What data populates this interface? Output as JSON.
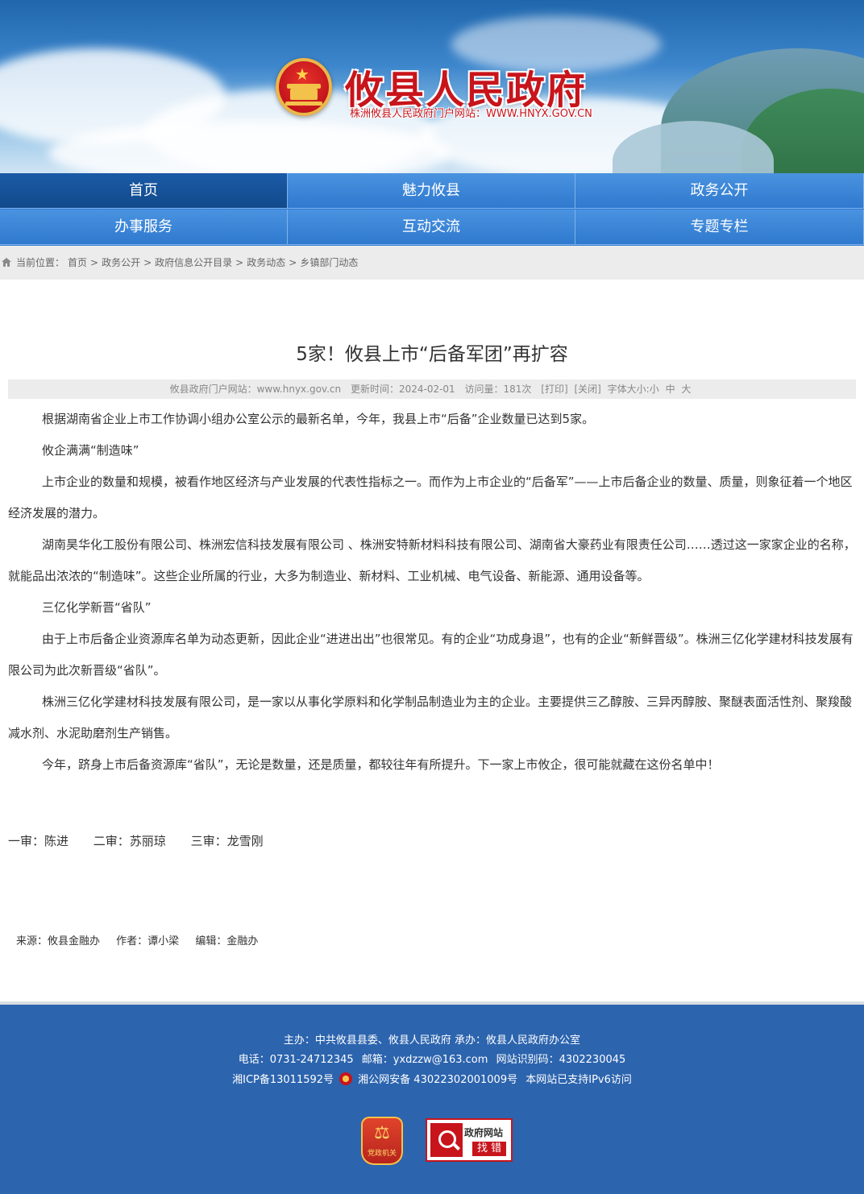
{
  "header": {
    "site_title": "攸县人民政府",
    "site_subtitle": "株洲攸县人民政府门户网站：WWW.HNYX.GOV.CN"
  },
  "nav": [
    {
      "label": "首页",
      "active": true
    },
    {
      "label": "魅力攸县",
      "active": false
    },
    {
      "label": "政务公开",
      "active": false
    },
    {
      "label": "办事服务",
      "active": false
    },
    {
      "label": "互动交流",
      "active": false
    },
    {
      "label": "专题专栏",
      "active": false
    }
  ],
  "breadcrumb": {
    "label": "当前位置：",
    "items": [
      "首页",
      "政务公开",
      "政府信息公开目录",
      "政务动态",
      "乡镇部门动态"
    ],
    "separator": ">"
  },
  "article": {
    "title": "5家！攸县上市“后备军团”再扩容",
    "meta": {
      "site": "攸县政府门户网站：www.hnyx.gov.cn",
      "updated": "更新时间：2024-02-01",
      "views": "访问量：181次",
      "print": "[打印]",
      "close": "[关闭]",
      "font_label": "字体大小:",
      "font_small": "小",
      "font_medium": "中",
      "font_large": "大"
    },
    "paragraphs": [
      "根据湖南省企业上市工作协调小组办公室公示的最新名单，今年，我县上市“后备”企业数量已达到5家。",
      "攸企满满“制造味”",
      "上市企业的数量和规模，被看作地区经济与产业发展的代表性指标之一。而作为上市企业的“后备军”——上市后备企业的数量、质量，则象征着一个地区经济发展的潜力。",
      "湖南昊华化工股份有限公司、株洲宏信科技发展有限公司 、株洲安特新材料科技有限公司、湖南省大豪药业有限责任公司……透过这一家家企业的名称，就能品出浓浓的“制造味”。这些企业所属的行业，大多为制造业、新材料、工业机械、电气设备、新能源、通用设备等。",
      "三亿化学新晋“省队”",
      "由于上市后备企业资源库名单为动态更新，因此企业“进进出出”也很常见。有的企业“功成身退”，也有的企业“新鲜晋级”。株洲三亿化学建材科技发展有限公司为此次新晋级“省队”。",
      "株洲三亿化学建材科技发展有限公司，是一家以从事化学原料和化学制品制造业为主的企业。主要提供三乙醇胺、三异丙醇胺、聚醚表面活性剂、聚羧酸减水剂、水泥助磨剂生产销售。",
      "今年，跻身上市后备资源库“省队”，无论是数量，还是质量，都较往年有所提升。下一家上市攸企，很可能就藏在这份名单中！"
    ],
    "review": [
      "一审：陈进",
      "二审：苏丽琼",
      "三审：龙雪刚"
    ],
    "source": [
      "来源：攸县金融办",
      "作者：谭小梁",
      "编辑：金融办"
    ]
  },
  "footer": {
    "line1": "主办：中共攸县县委、攸县人民政府 承办：攸县人民政府办公室",
    "phone": "电话：0731-24712345",
    "email": "邮箱：yxdzzw@163.com",
    "site_code": "网站识别码：4302230045",
    "icp": "湘ICP备13011592号",
    "police": "湘公网安备 43022302001009号",
    "ipv6": "本网站已支持IPv6访问",
    "badge_party": "党政机关",
    "badge_error_1": "政府网站",
    "badge_error_2": "找 错"
  },
  "colors": {
    "nav": "#2f7ad2",
    "nav_active": "#124a8c",
    "title_red": "#c8141b",
    "footer": "#2c64ae"
  }
}
